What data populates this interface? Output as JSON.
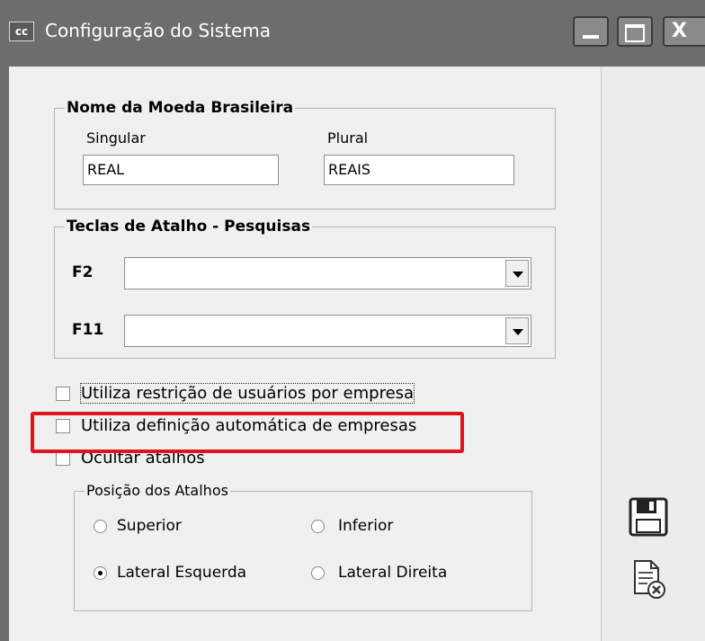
{
  "window": {
    "title": "Configuração do Sistema",
    "app_icon_text": "cc",
    "close_glyph": "X"
  },
  "currency_group": {
    "title": "Nome da Moeda Brasileira",
    "singular_label": "Singular",
    "singular_value": "REAL",
    "plural_label": "Plural",
    "plural_value": "REAIS"
  },
  "shortcut_group": {
    "title": "Teclas de Atalho - Pesquisas",
    "f2_label": "F2",
    "f2_value": "",
    "f11_label": "F11",
    "f11_value": ""
  },
  "options": {
    "restrict_users_label": "Utiliza restrição de usuários por empresa",
    "restrict_users_checked": false,
    "auto_company_label": "Utiliza definição automática de empresas",
    "auto_company_checked": false,
    "hide_shortcuts_label": "Ocultar atalhos",
    "hide_shortcuts_checked": false
  },
  "position_group": {
    "title": "Posição dos Atalhos",
    "superior_label": "Superior",
    "inferior_label": "Inferior",
    "left_label": "Lateral Esquerda",
    "right_label": "Lateral Direita",
    "selected": "Lateral Esquerda"
  },
  "side_actions": {
    "save_icon": "save-icon",
    "cancel_icon": "cancel-document-icon"
  },
  "colors": {
    "highlight_box": "#e1121a",
    "title_bar": "#6d6d6d"
  }
}
